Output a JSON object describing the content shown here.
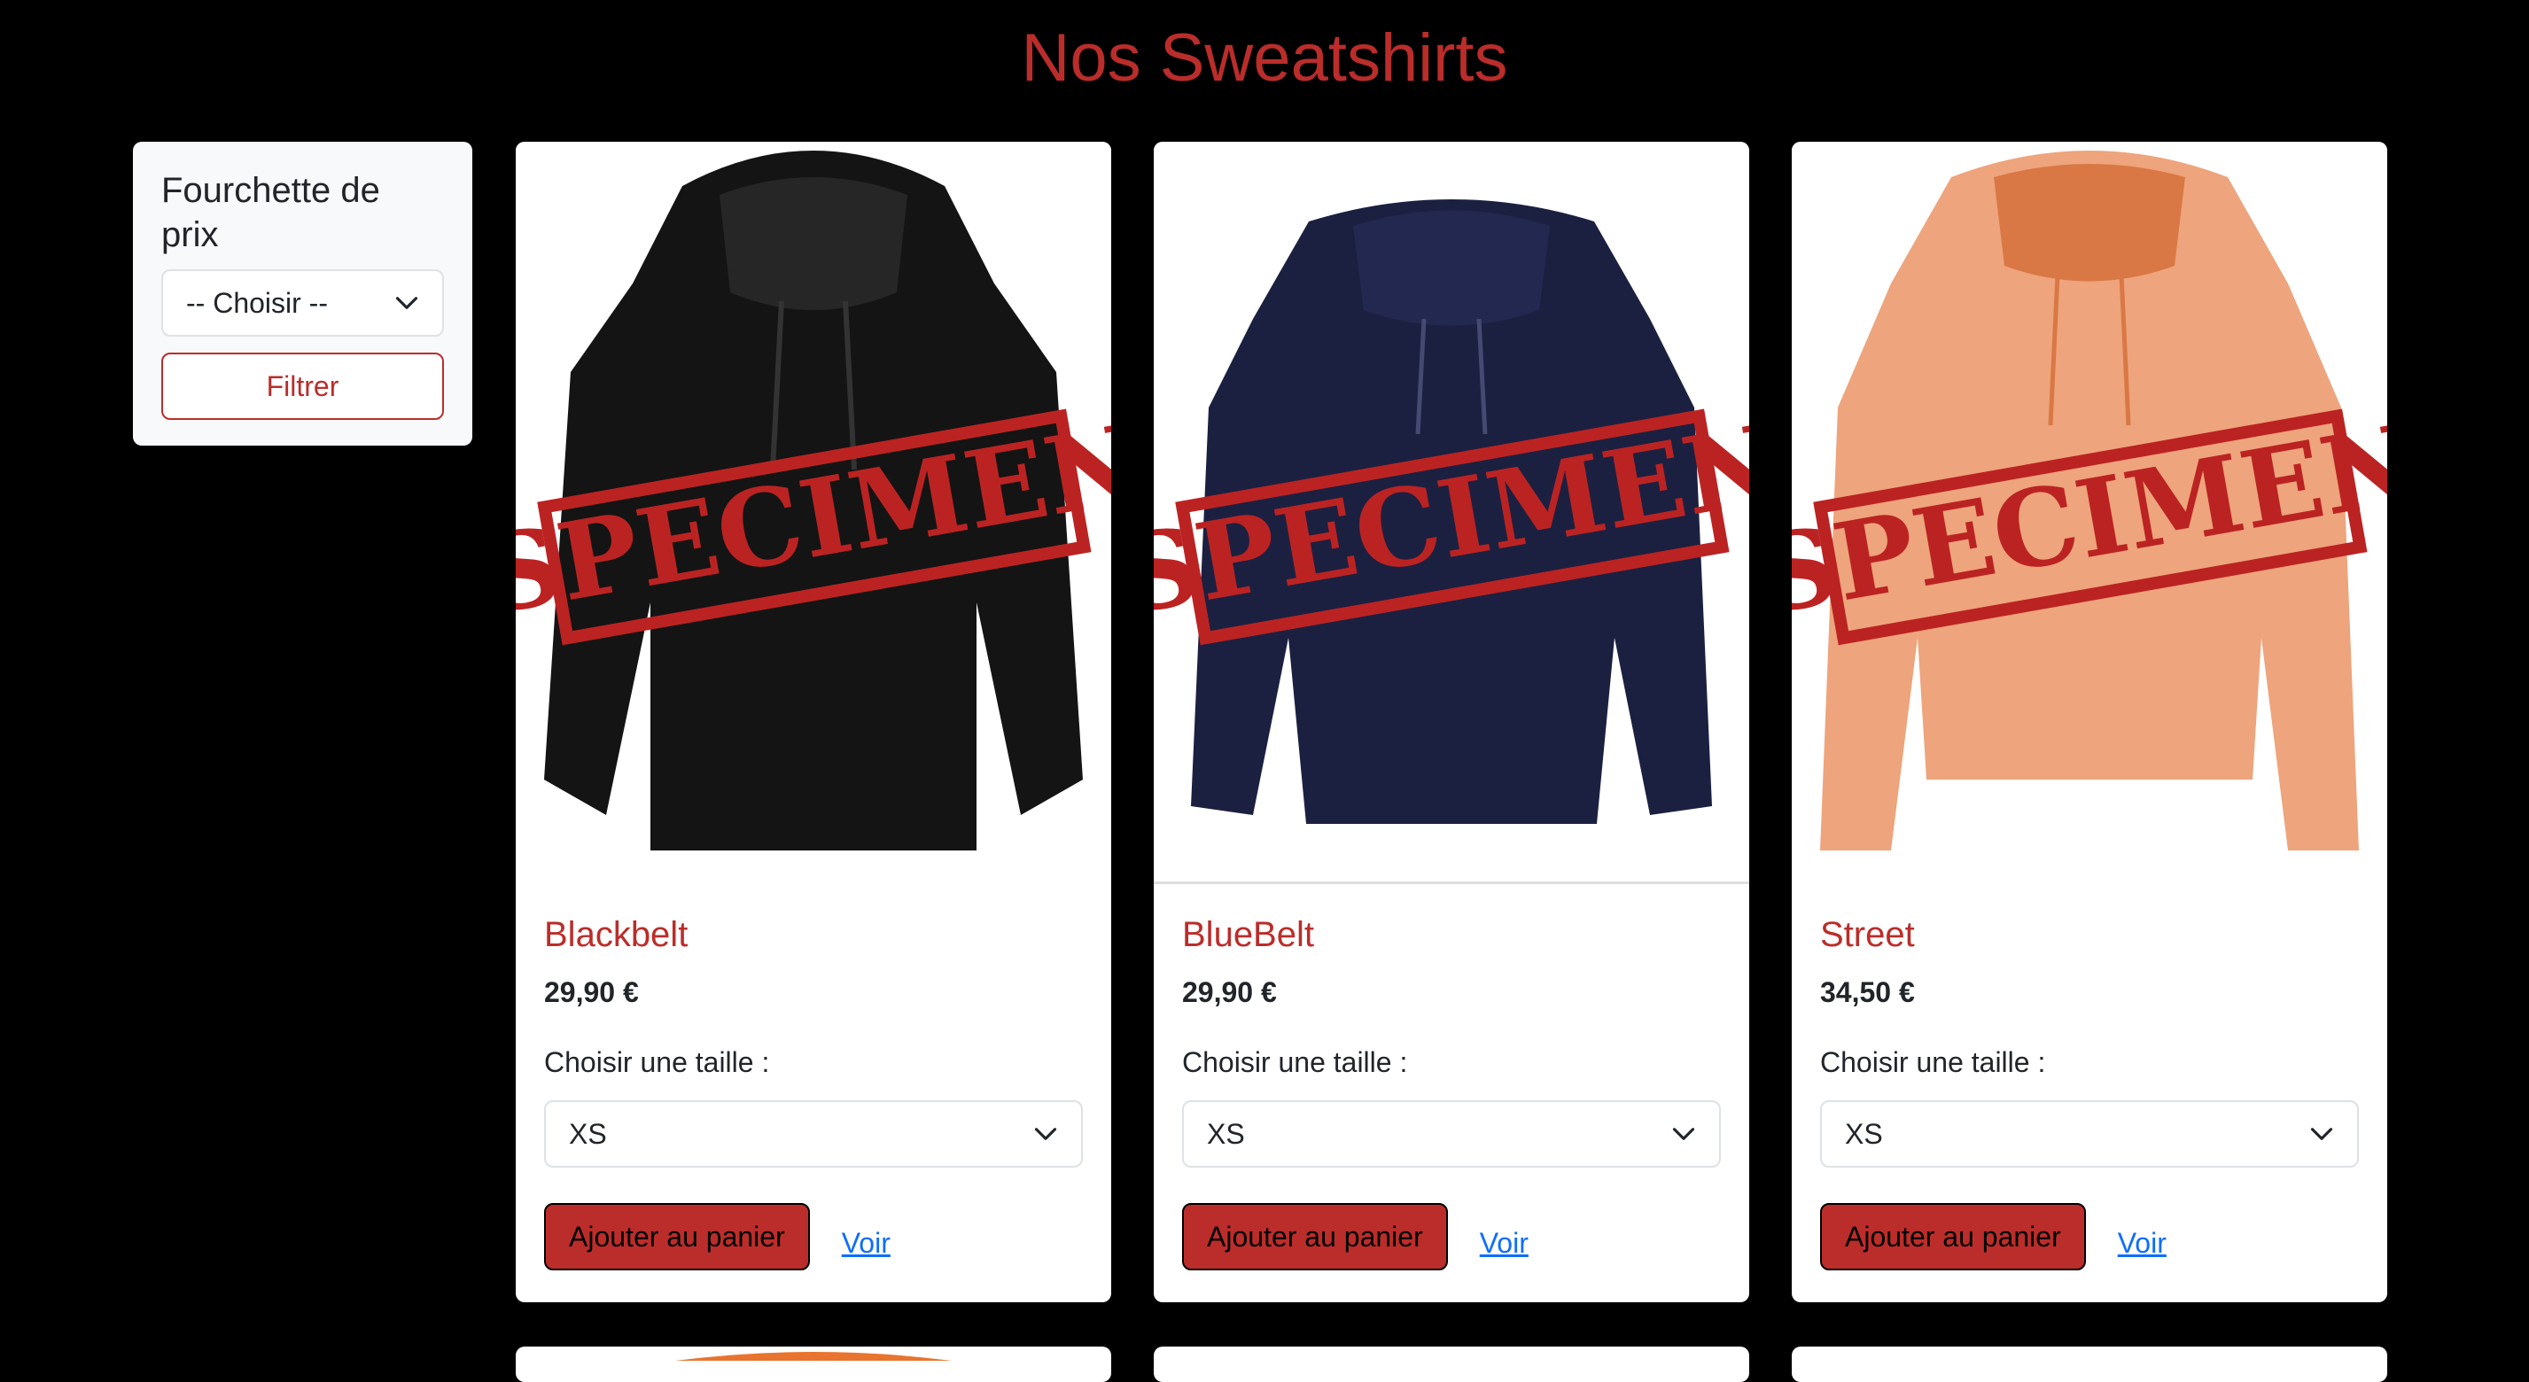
{
  "page": {
    "title": "Nos Sweatshirts"
  },
  "filter": {
    "title": "Fourchette de prix",
    "select_value": "-- Choisir --",
    "button_label": "Filtrer"
  },
  "products": [
    {
      "name": "Blackbelt",
      "price": "29,90 €",
      "size_label": "Choisir une taille :",
      "size_value": "XS",
      "add_label": "Ajouter au panier",
      "view_label": "Voir",
      "color": "#141414",
      "stamp": "SPECIMEN"
    },
    {
      "name": "BlueBelt",
      "price": "29,90 €",
      "size_label": "Choisir une taille :",
      "size_value": "XS",
      "add_label": "Ajouter au panier",
      "view_label": "Voir",
      "color": "#1c2040",
      "stamp": "SPECIMEN"
    },
    {
      "name": "Street",
      "price": "34,50 €",
      "size_label": "Choisir une taille :",
      "size_value": "XS",
      "add_label": "Ajouter au panier",
      "view_label": "Voir",
      "color": "#eea47c",
      "stamp": "SPECIMEN"
    }
  ],
  "colors": {
    "accent": "#bb2d2a",
    "link": "#0d6efd",
    "background": "#000000"
  }
}
